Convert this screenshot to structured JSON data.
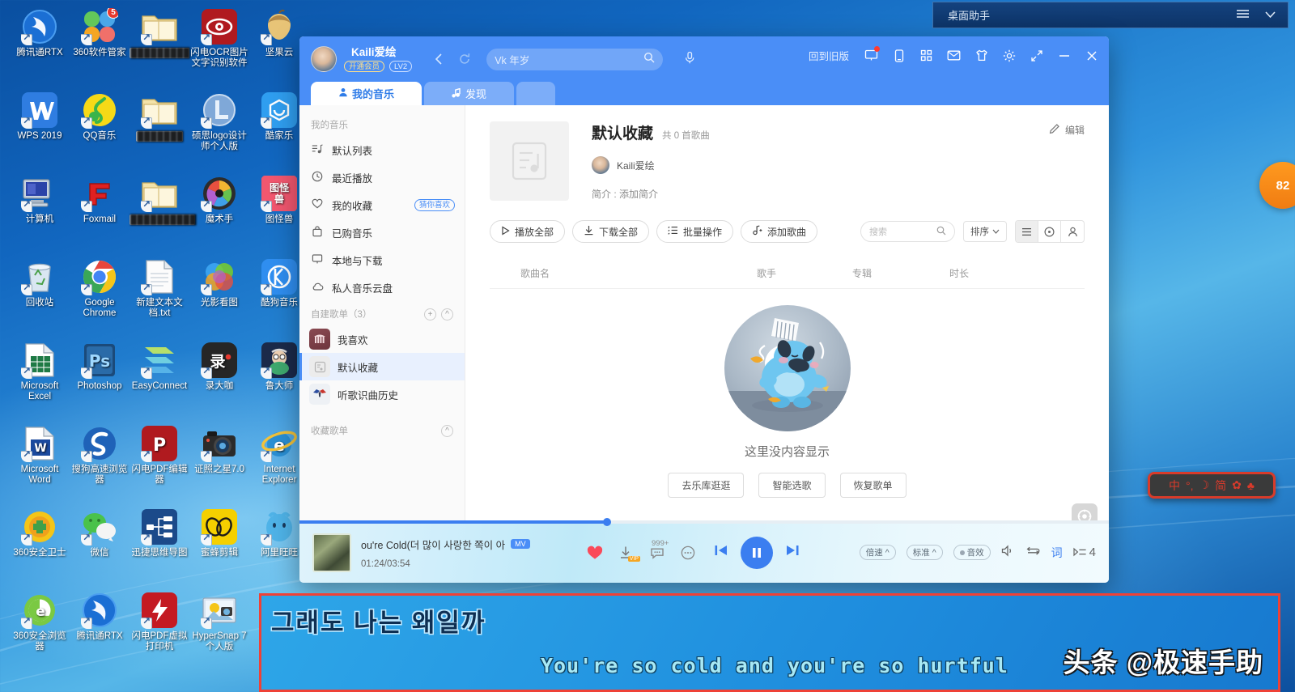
{
  "desktop": {
    "assistant_bar": {
      "title": "桌面助手",
      "menu_icon": "hamburger-icon",
      "collapse_icon": "chevron-down-icon"
    },
    "icons": [
      {
        "label": "腾讯通RTX",
        "redacted": false,
        "kind": "rtx",
        "row": 0,
        "col": 0
      },
      {
        "label": "360软件管家",
        "redacted": false,
        "kind": "360sw",
        "row": 0,
        "col": 1,
        "badge": "5"
      },
      {
        "label": "█████████",
        "redacted": true,
        "kind": "folder",
        "row": 0,
        "col": 2
      },
      {
        "label": "闪电OCR图片文字识别软件",
        "redacted": false,
        "kind": "ocr",
        "row": 0,
        "col": 3
      },
      {
        "label": "坚果云",
        "redacted": false,
        "kind": "nut",
        "row": 0,
        "col": 4
      },
      {
        "label": "WPS 2019",
        "redacted": false,
        "kind": "wps",
        "row": 1,
        "col": 0
      },
      {
        "label": "QQ音乐",
        "redacted": false,
        "kind": "qqmusic",
        "row": 1,
        "col": 1
      },
      {
        "label": "███████",
        "redacted": true,
        "kind": "folder",
        "row": 1,
        "col": 2
      },
      {
        "label": "硕思logo设计师个人版",
        "redacted": false,
        "kind": "logo",
        "row": 1,
        "col": 3
      },
      {
        "label": "酷家乐",
        "redacted": false,
        "kind": "kujiale",
        "row": 1,
        "col": 4
      },
      {
        "label": "计算机",
        "redacted": false,
        "kind": "computer",
        "row": 2,
        "col": 0
      },
      {
        "label": "Foxmail",
        "redacted": false,
        "kind": "foxmail",
        "row": 2,
        "col": 1
      },
      {
        "label": "██████████",
        "redacted": true,
        "kind": "folder",
        "row": 2,
        "col": 2
      },
      {
        "label": "魔术手",
        "redacted": false,
        "kind": "meitu",
        "row": 2,
        "col": 3
      },
      {
        "label": "图怪兽",
        "redacted": false,
        "kind": "tgs",
        "row": 2,
        "col": 4
      },
      {
        "label": "回收站",
        "redacted": false,
        "kind": "recycle",
        "row": 3,
        "col": 0
      },
      {
        "label": "Google Chrome",
        "redacted": false,
        "kind": "chrome",
        "row": 3,
        "col": 1
      },
      {
        "label": "新建文本文档.txt",
        "redacted": false,
        "kind": "txt",
        "row": 3,
        "col": 2
      },
      {
        "label": "光影看图",
        "redacted": false,
        "kind": "gykt",
        "row": 3,
        "col": 3
      },
      {
        "label": "酷狗音乐",
        "redacted": false,
        "kind": "kugou",
        "row": 3,
        "col": 4
      },
      {
        "label": "Microsoft Excel",
        "redacted": false,
        "kind": "excel",
        "row": 4,
        "col": 0
      },
      {
        "label": "Photoshop",
        "redacted": false,
        "kind": "ps",
        "row": 4,
        "col": 1
      },
      {
        "label": "EasyConnect",
        "redacted": false,
        "kind": "easyconnect",
        "row": 4,
        "col": 2
      },
      {
        "label": "录大咖",
        "redacted": false,
        "kind": "ludaka",
        "row": 4,
        "col": 3
      },
      {
        "label": "鲁大师",
        "redacted": false,
        "kind": "ludashi",
        "row": 4,
        "col": 4
      },
      {
        "label": "Microsoft Word",
        "redacted": false,
        "kind": "word",
        "row": 5,
        "col": 0
      },
      {
        "label": "搜狗高速浏览器",
        "redacted": false,
        "kind": "sogou",
        "row": 5,
        "col": 1
      },
      {
        "label": "闪电PDF编辑器",
        "redacted": false,
        "kind": "pdfedit",
        "row": 5,
        "col": 2
      },
      {
        "label": "证照之星7.0",
        "redacted": false,
        "kind": "camera",
        "row": 5,
        "col": 3
      },
      {
        "label": "Internet Explorer",
        "redacted": false,
        "kind": "ie",
        "row": 5,
        "col": 4
      },
      {
        "label": "360安全卫士",
        "redacted": false,
        "kind": "360safe",
        "row": 6,
        "col": 0
      },
      {
        "label": "微信",
        "redacted": false,
        "kind": "wechat",
        "row": 6,
        "col": 1
      },
      {
        "label": "迅捷思维导图",
        "redacted": false,
        "kind": "mindmap",
        "row": 6,
        "col": 2
      },
      {
        "label": "蜜蜂剪辑",
        "redacted": false,
        "kind": "bee",
        "row": 6,
        "col": 3
      },
      {
        "label": "阿里旺旺",
        "redacted": false,
        "kind": "aliww",
        "row": 6,
        "col": 4
      },
      {
        "label": "360安全浏览器",
        "redacted": false,
        "kind": "360br",
        "row": 7,
        "col": 0
      },
      {
        "label": "腾讯通RTX",
        "redacted": false,
        "kind": "rtx",
        "row": 7,
        "col": 1
      },
      {
        "label": "闪电PDF虚拟打印机",
        "redacted": false,
        "kind": "pdfprint",
        "row": 7,
        "col": 2
      },
      {
        "label": "HyperSnap 7 个人版",
        "redacted": false,
        "kind": "hypersnap",
        "row": 7,
        "col": 3
      }
    ],
    "orange_badge": "82",
    "ime": {
      "items": [
        "中",
        "°,",
        "☽",
        "简",
        "⚙",
        "👕"
      ]
    }
  },
  "kugou": {
    "user": {
      "name": "Kaili爱绘",
      "vip_tag": "开通会员",
      "level_tag": "LV2"
    },
    "nav": {
      "back_icon": "chevron-left-icon",
      "refresh_icon": "refresh-icon"
    },
    "search": {
      "value": "Vk 年岁",
      "icon": "search-icon",
      "mic_icon": "microphone-icon"
    },
    "topbar": {
      "old_version": "回到旧版",
      "icons": [
        "monitor-icon",
        "phone-icon",
        "grid-icon",
        "mail-icon",
        "shirt-icon",
        "gear-icon",
        "shrink-icon",
        "minimize-icon",
        "close-icon"
      ]
    },
    "tabs": [
      {
        "label": "我的音乐",
        "icon": "person-icon",
        "active": true
      },
      {
        "label": "发现",
        "icon": "note-icon",
        "active": false
      },
      {
        "label": "",
        "icon": "",
        "active": false
      }
    ],
    "sidebar": {
      "group1_title": "我的音乐",
      "items": [
        {
          "label": "默认列表",
          "icon": "list-note-icon"
        },
        {
          "label": "最近播放",
          "icon": "clock-icon"
        },
        {
          "label": "我的收藏",
          "icon": "heart-icon",
          "tag": "猜你喜欢"
        },
        {
          "label": "已购音乐",
          "icon": "bag-icon"
        },
        {
          "label": "本地与下载",
          "icon": "monitor-icon"
        },
        {
          "label": "私人音乐云盘",
          "icon": "cloud-icon"
        }
      ],
      "group2_title": "自建歌单（3）",
      "group2_add_icon": "plus-icon",
      "group2_collapse_icon": "chevron-up-icon",
      "playlists": [
        {
          "label": "我喜欢",
          "thumb": "a",
          "selected": false
        },
        {
          "label": "默认收藏",
          "thumb": "b",
          "selected": true
        },
        {
          "label": "听歌识曲历史",
          "thumb": "c",
          "selected": false
        }
      ],
      "group3_title": "收藏歌单",
      "group3_collapse_icon": "chevron-up-icon"
    },
    "playlist": {
      "cover_icon": "playlist-cover-icon",
      "title": "默认收藏",
      "count": "共 0 首歌曲",
      "owner": "Kaili爱绘",
      "desc": "简介 : 添加简介",
      "edit_label": "编辑",
      "edit_icon": "pencil-icon",
      "actions": [
        {
          "label": "播放全部",
          "icon": "play-icon"
        },
        {
          "label": "下载全部",
          "icon": "download-icon"
        },
        {
          "label": "批量操作",
          "icon": "batch-icon"
        },
        {
          "label": "添加歌曲",
          "icon": "add-note-icon"
        }
      ],
      "search_placeholder": "搜索",
      "search_icon": "search-icon",
      "sort_label": "排序",
      "sort_icon": "chevron-down-icon",
      "view_icons": [
        "list-view-icon",
        "disc-view-icon",
        "person-view-icon"
      ],
      "columns": [
        "歌曲名",
        "歌手",
        "专辑",
        "时长"
      ],
      "empty": {
        "illustration": "sad-dog-illustration",
        "caption": "这里没内容显示",
        "buttons": [
          "去乐库逛逛",
          "智能选歌",
          "恢复歌单"
        ]
      }
    },
    "player": {
      "track_title": "ou're Cold(더 많이 사랑한 쪽이 아",
      "mv_badge": "MV",
      "time": "01:24/03:54",
      "progress_percent": 38,
      "icons": {
        "like": "heart-filled-icon",
        "download": "download-icon",
        "download_tag": "VIP",
        "comment": "comment-icon",
        "comment_count": "999+",
        "more": "more-icon",
        "prev": "previous-icon",
        "play_pause": "pause-icon",
        "next": "next-icon",
        "volume": "volume-icon",
        "repeat": "repeat-icon",
        "lyrics": "词",
        "queue": "queue-icon"
      },
      "speed_label": "倍速",
      "quality_label": "标准",
      "effect_label": "音效",
      "queue_count": "4"
    },
    "float_buttons": [
      {
        "icon": "target-icon",
        "style": "gray"
      },
      {
        "icon": "phone-icon",
        "style": "blue"
      }
    ]
  },
  "lyrics": {
    "korean": "그래도 나는 왜일까",
    "english": "You're so cold and you're so hurtful"
  },
  "watermark": "头条 @极速手助",
  "colors": {
    "accent_blue": "#4a8ef7",
    "player_blue": "#3b7ef0",
    "vip_gold": "#ffe08a",
    "like_red": "#fa4a5a",
    "lyric_border": "#ef4136",
    "badge_orange": "#f07c12"
  }
}
